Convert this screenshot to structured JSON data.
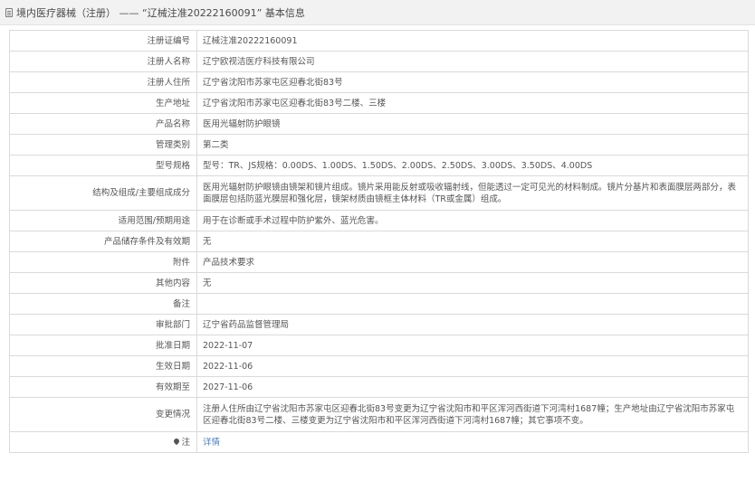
{
  "header": {
    "title": "境内医疗器械（注册） —— “辽械注准20222160091” 基本信息"
  },
  "rows": [
    {
      "label": "注册证编号",
      "value": "辽械注准20222160091"
    },
    {
      "label": "注册人名称",
      "value": "辽宁欧视洁医疗科技有限公司"
    },
    {
      "label": "注册人住所",
      "value": "辽宁省沈阳市苏家屯区迎春北街83号"
    },
    {
      "label": "生产地址",
      "value": "辽宁省沈阳市苏家屯区迎春北街83号二楼、三楼"
    },
    {
      "label": "产品名称",
      "value": "医用光辐射防护眼镜"
    },
    {
      "label": "管理类别",
      "value": "第二类"
    },
    {
      "label": "型号规格",
      "value": "型号：TR、JS规格：0.00DS、1.00DS、1.50DS、2.00DS、2.50DS、3.00DS、3.50DS、4.00DS"
    },
    {
      "label": "结构及组成/主要组成成分",
      "value": "医用光辐射防护眼镜由镜架和镜片组成。镜片采用能反射或吸收辐射线，但能透过一定可见光的材料制成。镜片分基片和表面膜层两部分，表面膜层包括防蓝光膜层和强化层，镜架材质由镜框主体材料（TR或金属）组成。"
    },
    {
      "label": "适用范围/预期用途",
      "value": "用于在诊断或手术过程中防护紫外、蓝光危害。"
    },
    {
      "label": "产品储存条件及有效期",
      "value": "无"
    },
    {
      "label": "附件",
      "value": "产品技术要求"
    },
    {
      "label": "其他内容",
      "value": "无"
    },
    {
      "label": "备注",
      "value": ""
    },
    {
      "label": "审批部门",
      "value": "辽宁省药品监督管理局"
    },
    {
      "label": "批准日期",
      "value": "2022-11-07"
    },
    {
      "label": "生效日期",
      "value": "2022-11-06"
    },
    {
      "label": "有效期至",
      "value": "2027-11-06"
    },
    {
      "label": "变更情况",
      "value": "注册人住所由辽宁省沈阳市苏家屯区迎春北街83号变更为辽宁省沈阳市和平区浑河西街道下河湾村1687幢；生产地址由辽宁省沈阳市苏家屯区迎春北街83号二楼、三楼变更为辽宁省沈阳市和平区浑河西街道下河湾村1687幢；其它事项不变。"
    }
  ],
  "footer_row": {
    "label": "注",
    "pin_icon": "location-pin-icon",
    "link": "详情"
  }
}
